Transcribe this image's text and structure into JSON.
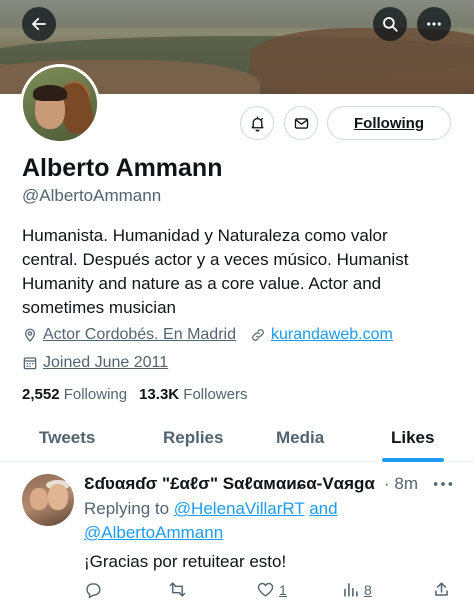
{
  "profile": {
    "name": "Alberto Ammann",
    "handle": "@AlbertoAmmann",
    "bio": "Humanista. Humanidad y Naturaleza como valor central. Después actor y a veces músico. Humanist Humanity and nature as a core value. Actor and sometimes musician",
    "location": "Actor Cordobés. En Madrid",
    "website": "kurandaweb.com",
    "joined": "Joined June 2011",
    "following_count": "2,552",
    "following_label": "Following",
    "followers_count": "13.3K",
    "followers_label": "Followers"
  },
  "header": {
    "back_icon": "back-arrow-icon",
    "search_icon": "search-icon",
    "more_icon": "more-icon"
  },
  "actions": {
    "following_button": "Following",
    "notify_icon": "bell-icon",
    "message_icon": "mail-icon"
  },
  "tabs": [
    {
      "label": "Tweets",
      "active": false
    },
    {
      "label": "Replies",
      "active": false
    },
    {
      "label": "Media",
      "active": false
    },
    {
      "label": "Likes",
      "active": true
    }
  ],
  "post": {
    "author": "Ɛɗʋαяɗσ \"£αℓσ\" Sαℓαмαиɕα-Vαяgα",
    "time": "· 8m",
    "replying_prefix": "Replying to",
    "mention1": "@HelenaVillarRT",
    "joiner": "and",
    "mention2": "@AlbertoAmmann",
    "text": "¡Gracias por retuitear esto!",
    "likes": "1",
    "views": "8"
  },
  "colors": {
    "accent": "#1d9bf0",
    "text_primary": "#0f1419",
    "text_secondary": "#536471",
    "border": "#cfd9de"
  }
}
